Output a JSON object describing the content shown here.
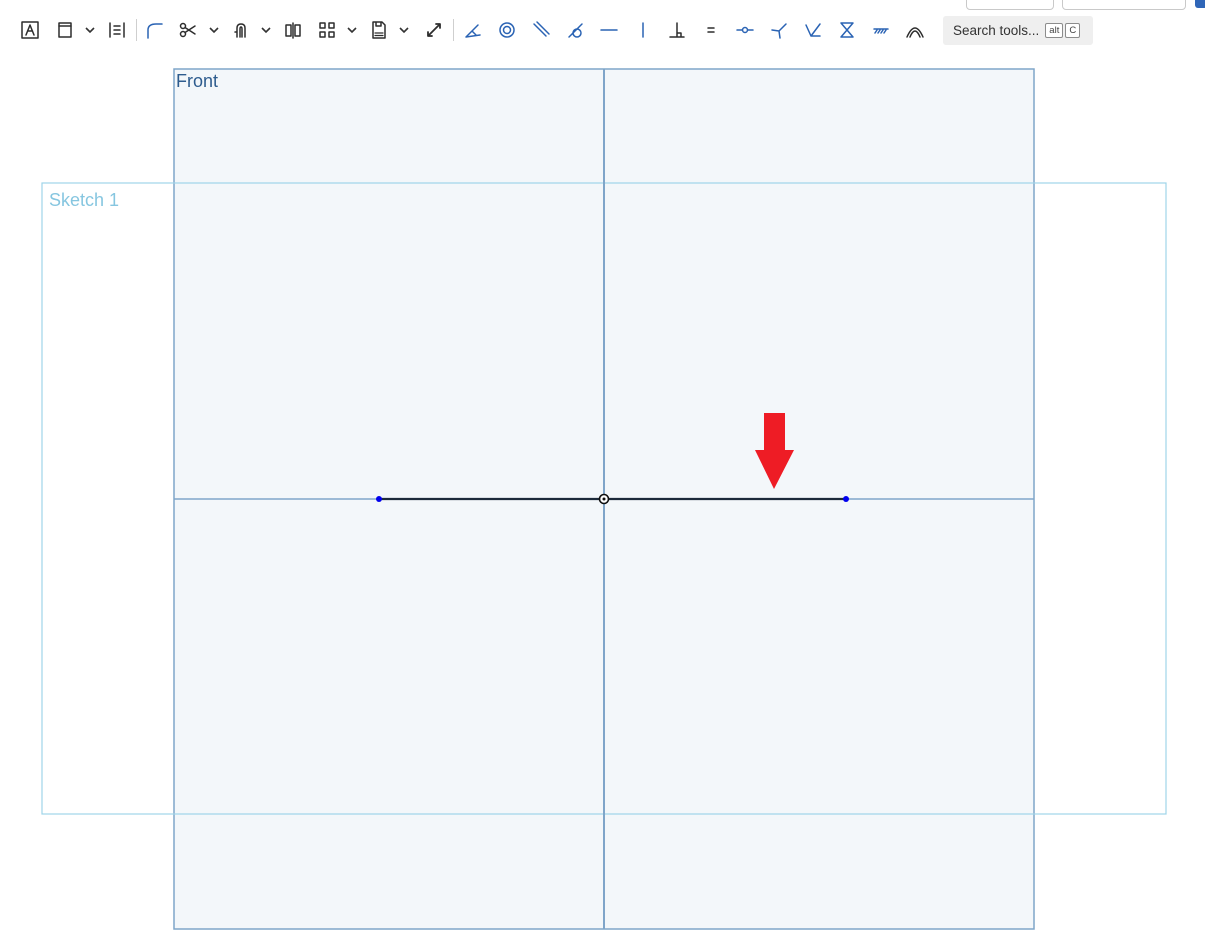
{
  "toolbar": {
    "tools": [
      {
        "name": "text-tool-icon"
      },
      {
        "name": "rectangle-tool-icon"
      },
      {
        "name": "dimension-tool-icon"
      },
      {
        "name": "fillet-tool-icon"
      },
      {
        "name": "trim-tool-icon"
      },
      {
        "name": "offset-tool-icon"
      },
      {
        "name": "mirror-tool-icon"
      },
      {
        "name": "pattern-tool-icon"
      },
      {
        "name": "dxf-import-icon"
      },
      {
        "name": "construction-toggle-icon"
      },
      {
        "name": "coincident-constraint-icon"
      },
      {
        "name": "concentric-constraint-icon"
      },
      {
        "name": "parallel-constraint-icon"
      },
      {
        "name": "tangent-constraint-icon"
      },
      {
        "name": "horizontal-constraint-icon"
      },
      {
        "name": "vertical-constraint-icon"
      },
      {
        "name": "perpendicular-constraint-icon"
      },
      {
        "name": "equal-constraint-icon"
      },
      {
        "name": "midpoint-constraint-icon"
      },
      {
        "name": "normal-constraint-icon"
      },
      {
        "name": "pierce-constraint-icon"
      },
      {
        "name": "symmetric-constraint-icon"
      },
      {
        "name": "fix-constraint-icon"
      },
      {
        "name": "curvature-constraint-icon"
      }
    ],
    "search": {
      "label": "Search tools...",
      "shortcut_alt": "alt",
      "shortcut_key": "C"
    }
  },
  "viewport": {
    "planes": {
      "front": "Front",
      "sketch": "Sketch 1"
    }
  },
  "colors": {
    "front_plane_fill": "#f3f7fa",
    "front_plane_stroke": "#7fa5c9",
    "sketch_plane_stroke": "#9fd4e8",
    "sketch_line": "#1c2a3a",
    "endpoint": "#0000ee",
    "arrow": "#ee1c25"
  }
}
